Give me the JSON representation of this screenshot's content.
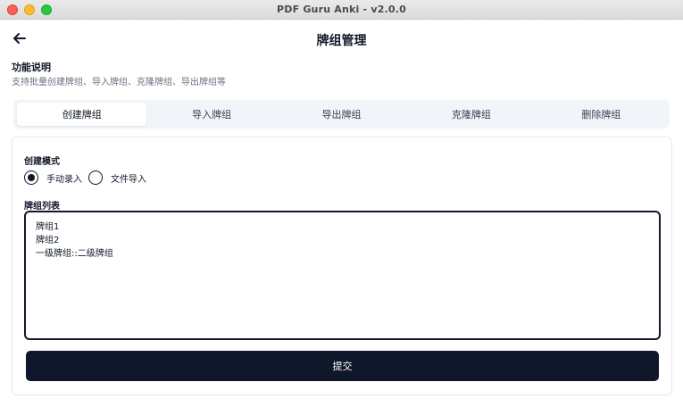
{
  "window": {
    "title": "PDF Guru Anki - v2.0.0"
  },
  "header": {
    "back_icon": "arrow-left-icon",
    "title": "牌组管理"
  },
  "description": {
    "title": "功能说明",
    "text": "支持批量创建牌组、导入牌组、克隆牌组、导出牌组等"
  },
  "tabs": [
    {
      "label": "创建牌组",
      "active": true
    },
    {
      "label": "导入牌组",
      "active": false
    },
    {
      "label": "导出牌组",
      "active": false
    },
    {
      "label": "克隆牌组",
      "active": false
    },
    {
      "label": "删除牌组",
      "active": false
    }
  ],
  "form": {
    "mode_label": "创建模式",
    "modes": [
      {
        "label": "手动录入",
        "selected": true
      },
      {
        "label": "文件导入",
        "selected": false
      }
    ],
    "list_label": "牌组列表",
    "list_value": "牌组1\n牌组2\n一级牌组::二级牌组",
    "submit_label": "提交"
  },
  "colors": {
    "primary": "#0f172a",
    "muted_text": "#6b7280",
    "tab_bg": "#f1f5f9",
    "traffic_red": "#ff5f57",
    "traffic_yellow": "#febc2e",
    "traffic_green": "#28c840"
  }
}
